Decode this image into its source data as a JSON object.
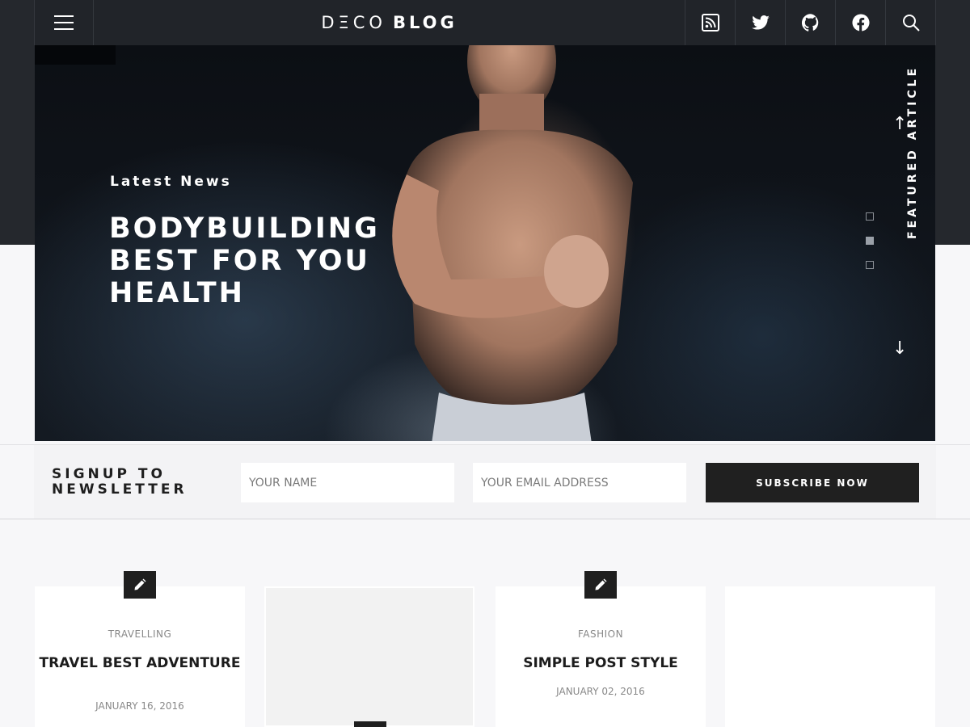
{
  "header": {
    "logo_deco": "DΞCO",
    "logo_blog": "BLOG",
    "icons": [
      "menu-icon",
      "rss-icon",
      "twitter-icon",
      "github-icon",
      "facebook-icon",
      "search-icon"
    ]
  },
  "hero": {
    "subtitle": "Latest News",
    "title": "BODYBUILDING BEST FOR YOU HEALTH",
    "featured_label": "FEATURED ARTICLE",
    "slides": {
      "count": 3,
      "active": 2
    }
  },
  "newsletter": {
    "title": "SIGNUP TO NEWSLETTER",
    "name_placeholder": "YOUR NAME",
    "email_placeholder": "YOUR EMAIL ADDRESS",
    "button_label": "SUBSCRIBE NOW"
  },
  "posts": [
    {
      "category": "TRAVELLING",
      "title": "TRAVEL BEST ADVENTURE",
      "date": "JANUARY 16, 2016"
    },
    {
      "category": "FASHION",
      "title": "SIMPLE POST STYLE",
      "date": "JANUARY 02, 2016"
    }
  ],
  "colors": {
    "header_bg": "#212429",
    "accent_dark": "#202020"
  }
}
